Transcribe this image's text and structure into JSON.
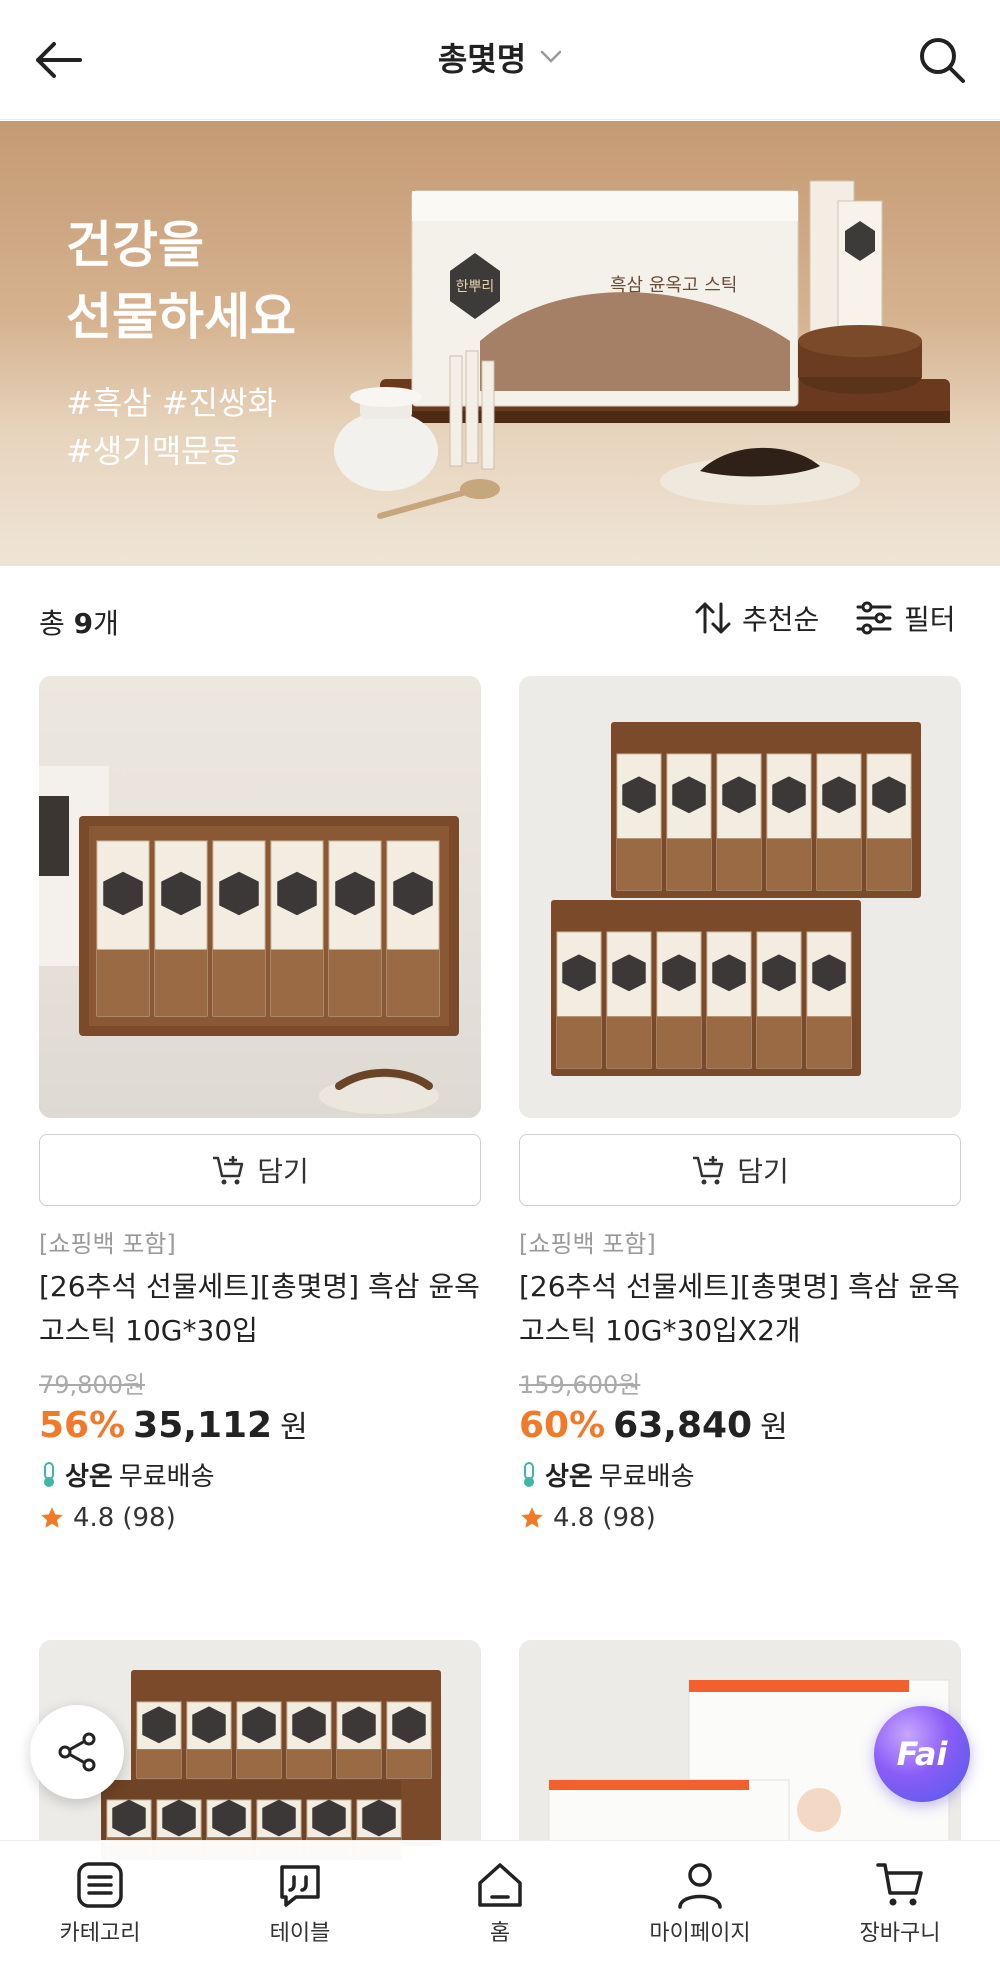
{
  "header": {
    "title": "총몇명"
  },
  "banner": {
    "title": "건강을\n선물하세요",
    "tags": "#흑삼 #진쌍화\n#생기맥문동",
    "box_label": "흑삼 윤옥고 스틱",
    "seal_text": "한뿌리"
  },
  "toolbar": {
    "count_prefix": "총",
    "count_value": "9",
    "count_suffix": "개",
    "sort_label": "추천순",
    "filter_label": "필터"
  },
  "products": [
    {
      "cart_label": "담기",
      "badge": "[쇼핑백 포함]",
      "name": "[26추석 선물세트][총몇명] 흑삼 윤옥고스틱 10G*30입",
      "original_price": "79,800원",
      "discount": "56%",
      "price": "35,112",
      "currency": "원",
      "shipping_brand": "상온",
      "shipping_text": "무료배송",
      "rating": "4.8",
      "reviews": "(98)"
    },
    {
      "cart_label": "담기",
      "badge": "[쇼핑백 포함]",
      "name": "[26추석 선물세트][총몇명] 흑삼 윤옥고스틱 10G*30입X2개",
      "original_price": "159,600원",
      "discount": "60%",
      "price": "63,840",
      "currency": "원",
      "shipping_brand": "상온",
      "shipping_text": "무료배송",
      "rating": "4.8",
      "reviews": "(98)"
    }
  ],
  "fai": {
    "label": "Fai"
  },
  "bottom_nav": [
    {
      "label": "카테고리",
      "icon": "category-icon"
    },
    {
      "label": "테이블",
      "icon": "chat-quote-icon"
    },
    {
      "label": "홈",
      "icon": "home-icon"
    },
    {
      "label": "마이페이지",
      "icon": "person-icon"
    },
    {
      "label": "장바구니",
      "icon": "cart-icon"
    }
  ],
  "colors": {
    "accent_discount": "#f07a2a",
    "product_brown": "#7a4a2a",
    "fai_gradient_end": "#4f5ce8"
  }
}
